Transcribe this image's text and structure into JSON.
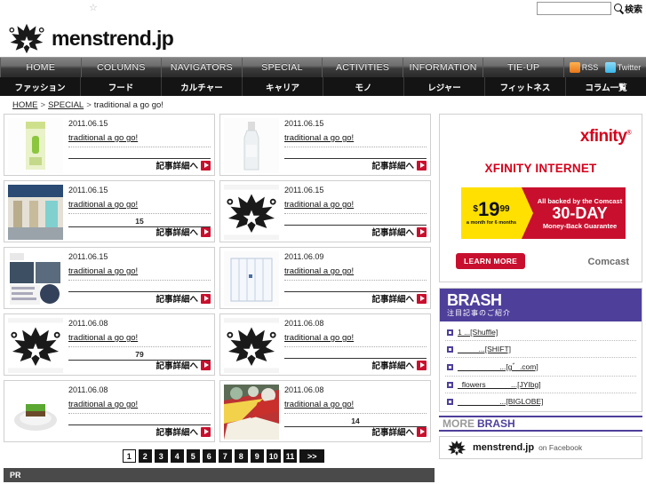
{
  "browser": {
    "bookmark_star": "☆"
  },
  "search": {
    "value": "",
    "placeholder": "",
    "button_label": "検索",
    "icon": "search-icon"
  },
  "header": {
    "site_title": "menstrend.jp",
    "logo_icon": "crown-logo-icon"
  },
  "nav_main": {
    "items": [
      {
        "label": "HOME"
      },
      {
        "label": "COLUMNS"
      },
      {
        "label": "NAVIGATORS"
      },
      {
        "label": "SPECIAL"
      },
      {
        "label": "ACTIVITIES"
      },
      {
        "label": "INFORMATION"
      },
      {
        "label": "TIE-UP"
      }
    ],
    "social": [
      {
        "label": "RSS",
        "icon": "rss-icon"
      },
      {
        "label": "Twitter",
        "icon": "twitter-icon"
      }
    ]
  },
  "nav_sub": {
    "items": [
      {
        "label": "ファッション"
      },
      {
        "label": "フード"
      },
      {
        "label": "カルチャー"
      },
      {
        "label": "キャリア"
      },
      {
        "label": "モノ"
      },
      {
        "label": "レジャー"
      },
      {
        "label": "フィットネス"
      },
      {
        "label": "コラム一覧"
      }
    ]
  },
  "breadcrumb": {
    "home": "HOME",
    "sep1": ">",
    "section": "SPECIAL",
    "sep2": ">",
    "current": "traditional a go go!"
  },
  "articles": {
    "more_label": "記事詳細へ",
    "items": [
      {
        "date": "2011.06.15",
        "title": "traditional a go go!",
        "desc": "",
        "thumb": "green-package-photo"
      },
      {
        "date": "2011.06.15",
        "title": "traditional a go go!",
        "desc": "",
        "thumb": "bottle-photo"
      },
      {
        "date": "2011.06.15",
        "title": "traditional a go go!",
        "desc": "15",
        "thumb": "storefront-photo"
      },
      {
        "date": "2011.06.15",
        "title": "traditional a go go!",
        "desc": "",
        "thumb": "crown-logo-icon"
      },
      {
        "date": "2011.06.15",
        "title": "traditional a go go!",
        "desc": "",
        "thumb": "magazine-spread-photo"
      },
      {
        "date": "2011.06.09",
        "title": "traditional a go go!",
        "desc": "",
        "thumb": "sliding-door-photo"
      },
      {
        "date": "2011.06.08",
        "title": "traditional a go go!",
        "desc": "79",
        "thumb": "crown-logo-icon"
      },
      {
        "date": "2011.06.08",
        "title": "traditional a go go!",
        "desc": "",
        "thumb": "crown-logo-icon"
      },
      {
        "date": "2011.06.08",
        "title": "traditional a go go!",
        "desc": "",
        "thumb": "green-cake-photo"
      },
      {
        "date": "2011.06.08",
        "title": "traditional a go go!",
        "desc": "14",
        "thumb": "rice-bowls-photo"
      }
    ]
  },
  "pagination": {
    "pages": [
      "1",
      "2",
      "3",
      "4",
      "5",
      "6",
      "7",
      "8",
      "9",
      "10",
      "11"
    ],
    "active": "1",
    "next_label": ">>"
  },
  "sidebar": {
    "ad": {
      "brand": "xfinity",
      "brand_mark": "®",
      "headline": "XFINITY INTERNET",
      "price_currency": "$",
      "price_main": "19",
      "price_cents": "99",
      "price_sub": "a month for 6 months",
      "guarantee_top": "All backed by the Comcast",
      "guarantee_main": "30-DAY",
      "guarantee_bottom": "Money-Back Guarantee",
      "cta": "LEARN MORE",
      "provider": "Comcast"
    },
    "brash": {
      "title": "BRASH",
      "subtitle": "注目記事のご紹介",
      "items": [
        {
          "text": "1         ...[Shuffle]"
        },
        {
          "text": "_____...[SHIFT]"
        },
        {
          "text": "__________...[g゛.com]"
        },
        {
          "text": "_flowers______...[JYIbg]"
        },
        {
          "text": "__________...[BIGLOBE]"
        }
      ],
      "more_prefix": "MORE",
      "more_brand": "BRASH"
    },
    "facebook": {
      "name": "menstrend.jp",
      "suffix": "on Facebook",
      "icon": "crown-logo-icon"
    }
  },
  "footer": {
    "pr_label": "PR"
  },
  "colors": {
    "accent_red": "#c8102e",
    "brash_purple": "#4e3f9b",
    "xfinity_red": "#d6001c",
    "nav_dark": "#141414"
  }
}
